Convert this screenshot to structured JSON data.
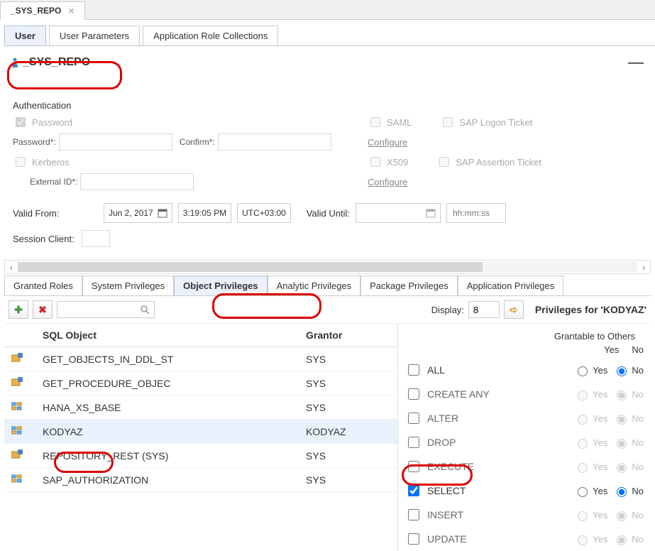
{
  "window_tab": "_SYS_REPO",
  "main_tabs": [
    "User",
    "User Parameters",
    "Application Role Collections"
  ],
  "user_title": "_SYS_REPO",
  "auth": {
    "section_label": "Authentication",
    "password_label": "Password",
    "password_field_label": "Password*:",
    "confirm_label": "Confirm*:",
    "saml_label": "SAML",
    "sap_logon_label": "SAP Logon Ticket",
    "configure1": "Configure",
    "kerberos_label": "Kerberos",
    "external_id_label": "External ID*:",
    "x509_label": "X509",
    "sap_assertion_label": "SAP Assertion Ticket",
    "configure2": "Configure"
  },
  "valid_from_label": "Valid From:",
  "valid_from_date": "Jun 2, 2017",
  "valid_from_time": "3:19:05 PM",
  "valid_from_tz": "UTC+03:00",
  "valid_until_label": "Valid Until:",
  "valid_until_time_placeholder": "hh:mm:ss",
  "session_client_label": "Session Client:",
  "priv_tabs": [
    "Granted Roles",
    "System Privileges",
    "Object Privileges",
    "Analytic Privileges",
    "Package Privileges",
    "Application Privileges"
  ],
  "display_label": "Display:",
  "display_value": "8",
  "priv_for": "Privileges for 'KODYAZ'",
  "grantable_label": "Grantable to Others",
  "yes_label": "Yes",
  "no_label": "No",
  "columns": {
    "sql_object": "SQL Object",
    "grantor": "Grantor"
  },
  "rows": [
    {
      "obj": "GET_OBJECTS_IN_DDL_ST",
      "grantor": "SYS",
      "icon": "proc"
    },
    {
      "obj": "GET_PROCEDURE_OBJEC",
      "grantor": "SYS",
      "icon": "proc"
    },
    {
      "obj": "HANA_XS_BASE",
      "grantor": "SYS",
      "icon": "schema"
    },
    {
      "obj": "KODYAZ",
      "grantor": "KODYAZ",
      "icon": "schema",
      "selected": true
    },
    {
      "obj": "REPOSITORY_REST (SYS)",
      "grantor": "SYS",
      "icon": "proc"
    },
    {
      "obj": "SAP_AUTHORIZATION",
      "grantor": "SYS",
      "icon": "schema"
    }
  ],
  "privileges": [
    {
      "name": "ALL",
      "checked": false,
      "enabled": true,
      "sel": "no"
    },
    {
      "name": "CREATE ANY",
      "checked": false,
      "enabled": false,
      "sel": "no"
    },
    {
      "name": "ALTER",
      "checked": false,
      "enabled": false,
      "sel": "no"
    },
    {
      "name": "DROP",
      "checked": false,
      "enabled": false,
      "sel": "no"
    },
    {
      "name": "EXECUTE",
      "checked": false,
      "enabled": false,
      "sel": "no"
    },
    {
      "name": "SELECT",
      "checked": true,
      "enabled": true,
      "sel": "no"
    },
    {
      "name": "INSERT",
      "checked": false,
      "enabled": false,
      "sel": "no"
    },
    {
      "name": "UPDATE",
      "checked": false,
      "enabled": false,
      "sel": "no"
    }
  ]
}
